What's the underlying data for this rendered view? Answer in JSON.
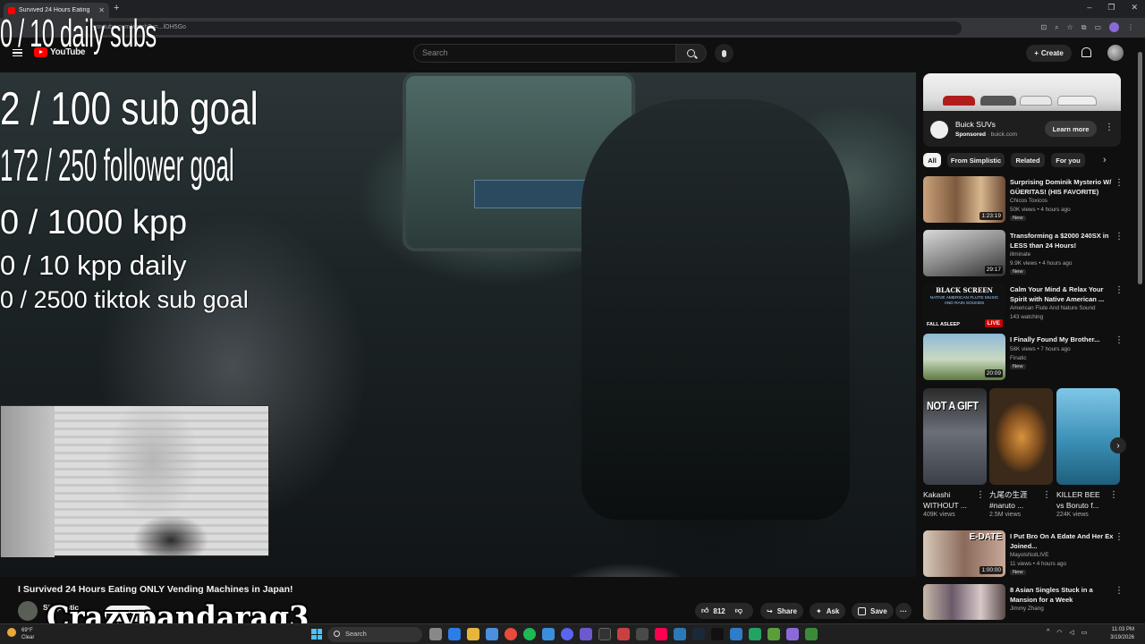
{
  "browser": {
    "tab_title": "Survived 24 Hours Eating",
    "new_tab": "+",
    "url_visible": "youtube.com/watch?v=...lOH5Go",
    "window_controls": [
      "–",
      "❐",
      "✕"
    ]
  },
  "youtube": {
    "logo_text": "YouTube",
    "search_placeholder": "Search",
    "create_label": "Create"
  },
  "overlays": {
    "daily_subs": "0 / 10 daily subs",
    "sub_goal": "2 / 100 sub goal",
    "follower_goal": "172 / 250 follower goal",
    "kpp": "0 / 1000 kpp",
    "kpp_daily": "0 / 10 kpp daily",
    "tiktok": "0 / 2500 tiktok sub goal",
    "streamer_name": "Crazypandarag3"
  },
  "video": {
    "title": "I Survived 24 Hours Eating ONLY Vending Machines in Japan!",
    "channel": "Simplistic",
    "subscribe_label": "Subscribe",
    "likes": "812",
    "share_label": "Share",
    "ask_label": "Ask",
    "save_label": "Save",
    "more_label": "···"
  },
  "ad": {
    "title": "Buick SUVs",
    "sponsored": "Sponsored",
    "domain": "buick.com",
    "cta": "Learn more"
  },
  "chips": [
    "All",
    "From Simplistic",
    "Related",
    "For you"
  ],
  "recommendations": [
    {
      "title": "Surprising Dominik Mysterio W/ GÜERITAS! (HIS FAVORITE)",
      "channel": "Chicos Toxicos",
      "meta": "50K views • 4 hours ago",
      "badge": "New",
      "duration": "1:23:19"
    },
    {
      "title": "Transforming a $2000 240SX in LESS than 24 Hours!",
      "channel": "illminate",
      "meta": "9.9K views • 4 hours ago",
      "badge": "New",
      "duration": "29:17"
    },
    {
      "title": "Calm Your Mind & Relax Your Spirit with Native American ...",
      "channel": "American Flute And Nature Sound",
      "meta": "143 watching",
      "badge": "",
      "duration": "LIVE"
    },
    {
      "title": "I Finally Found My Brother...",
      "channel": "Finatic",
      "meta": "58K views • 7 hours ago",
      "badge": "New",
      "duration": "20:09"
    },
    {
      "title": "I Put Bro On A Edate And Her Ex Joined...",
      "channel": "MayolsNotLIVE",
      "meta": "11 views • 4 hours ago",
      "badge": "New",
      "duration": "1:00:00"
    },
    {
      "title": "8 Asian Singles Stuck in a Mansion for a Week",
      "channel": "Jimmy Zhang",
      "meta": "",
      "badge": "",
      "duration": ""
    }
  ],
  "thumb_texts": {
    "blackscreen": "BLACK SCREEN",
    "flute": "NATIVE AMERICAN FLUTE MUSIC AND RAIN SOUNDS",
    "fall_asleep": "FALL ASLEEP",
    "notgift": "NOT A GIFT",
    "edate": "E-DATE"
  },
  "shorts": [
    {
      "title": "Kakashi WITHOUT ...",
      "views": "409K views"
    },
    {
      "title": "九尾の生涯 #naruto ...",
      "views": "2.5M views"
    },
    {
      "title": "KILLER BEE vs Boruto f...",
      "views": "224K views"
    }
  ],
  "taskbar": {
    "weather_temp": "69°F",
    "weather_desc": "Clear",
    "search_label": "Search",
    "time": "11:03 PM",
    "date": "3/19/2026"
  },
  "colors": {
    "background": "#0f0f0f",
    "youtube_red": "#ff0000",
    "chip_bg": "#272727"
  }
}
